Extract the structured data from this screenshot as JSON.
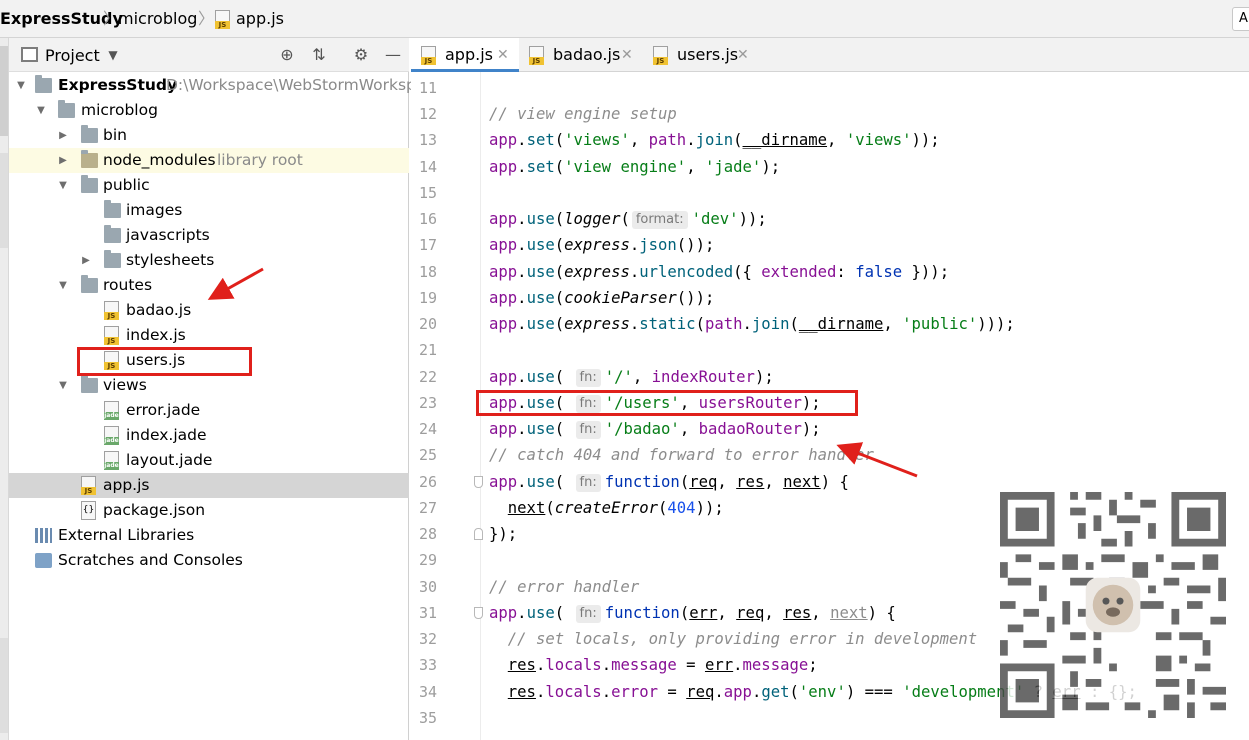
{
  "breadcrumb": {
    "items": [
      "ExpressStudy",
      "microblog",
      "app.js"
    ],
    "search_stub": "A"
  },
  "project_panel": {
    "title": "Project",
    "icons": [
      "project-icon",
      "dropdown-icon",
      "locate-icon",
      "collapse-all-icon",
      "gear-icon",
      "hide-icon"
    ],
    "tree": [
      {
        "label": "ExpressStudy",
        "extra": "D:\\Workspace\\WebStormWorksp"
      },
      {
        "label": "microblog"
      },
      {
        "label": "bin"
      },
      {
        "label": "node_modules",
        "extra": "library root"
      },
      {
        "label": "public"
      },
      {
        "label": "images"
      },
      {
        "label": "javascripts"
      },
      {
        "label": "stylesheets"
      },
      {
        "label": "routes"
      },
      {
        "label": "badao.js"
      },
      {
        "label": "index.js"
      },
      {
        "label": "users.js"
      },
      {
        "label": "views"
      },
      {
        "label": "error.jade"
      },
      {
        "label": "index.jade"
      },
      {
        "label": "layout.jade"
      },
      {
        "label": "app.js",
        "selected": true
      },
      {
        "label": "package.json"
      },
      {
        "label": "External Libraries"
      },
      {
        "label": "Scratches and Consoles"
      }
    ]
  },
  "tabs": [
    {
      "label": "app.js",
      "active": true
    },
    {
      "label": "badao.js"
    },
    {
      "label": "users.js"
    }
  ],
  "file_icon_tags": {
    "js": "JS",
    "jade": "jade"
  },
  "editor": {
    "line_numbers": [
      "11",
      "12",
      "13",
      "14",
      "15",
      "16",
      "17",
      "18",
      "19",
      "20",
      "21",
      "22",
      "23",
      "24",
      "25",
      "26",
      "27",
      "28",
      "29",
      "30",
      "31",
      "32",
      "33",
      "34",
      "35"
    ],
    "hints": {
      "format": "format:",
      "fn": "fn:"
    },
    "strings": {
      "c12": "// view engine setup",
      "c25": "// catch 404 and forward to error handler",
      "c30": "// error handler",
      "c32": "// set locals, only providing error in development",
      "views": "'views'",
      "view_engine": "'view engine'",
      "jade": "'jade'",
      "dev": "'dev'",
      "public": "'public'",
      "root": "'/'",
      "users": "'/users'",
      "badao": "'/badao'",
      "env": "'env'",
      "development": "'development'",
      "n404": "404"
    }
  },
  "colors": {
    "annotation_red": "#e0201b",
    "active_tab_accent": "#4083c9",
    "selection": "#d5d5d5"
  }
}
